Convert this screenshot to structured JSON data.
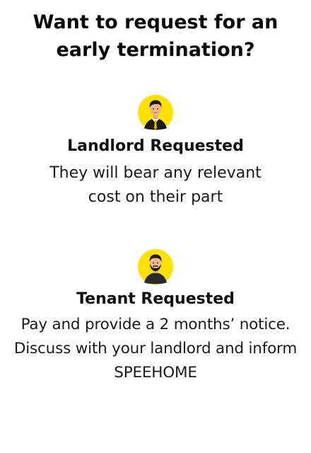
{
  "header": {
    "title": "Want to request for an early termination?"
  },
  "options": [
    {
      "icon": "businessman-avatar-icon",
      "title": "Landlord Requested",
      "description": "They will bear any relevant cost on their part"
    },
    {
      "icon": "bearded-man-avatar-icon",
      "title": "Tenant Requested",
      "description": "Pay and provide a 2 months’ notice. Discuss with your landlord and inform SPEEHOME"
    }
  ],
  "colors": {
    "avatar_background": "#FFE100",
    "text": "#111111"
  }
}
